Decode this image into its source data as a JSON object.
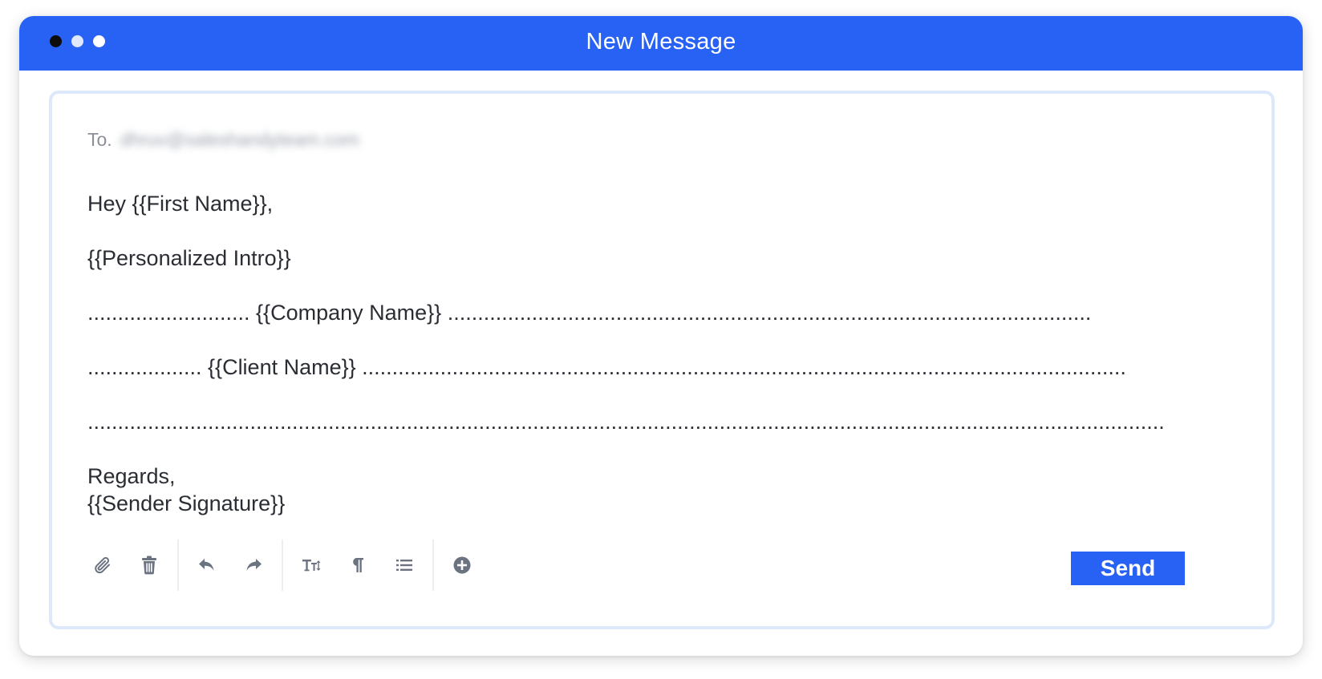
{
  "window": {
    "title": "New Message"
  },
  "compose": {
    "to_label": "To.",
    "to_value": "dhruv@saleshandyteam.com",
    "body_lines": [
      "Hey {{First Name}},",
      "",
      "{{Personalized Intro}}",
      "",
      "........................... {{Company Name}} ...........................................................................................................",
      "",
      "................... {{Client Name}} ...............................................................................................................................",
      "",
      "...................................................................................................................................................................................",
      "",
      "Regards,",
      "{{Sender Signature}}"
    ]
  },
  "toolbar": {
    "send_label": "Send",
    "tools": [
      "paperclip-icon",
      "trash-icon",
      "undo-icon",
      "redo-icon",
      "text-size-icon",
      "paragraph-icon",
      "list-icon",
      "add-circle-icon"
    ]
  },
  "colors": {
    "accent": "#2862f5",
    "icon": "#6b7280",
    "text": "#2a2d33"
  }
}
